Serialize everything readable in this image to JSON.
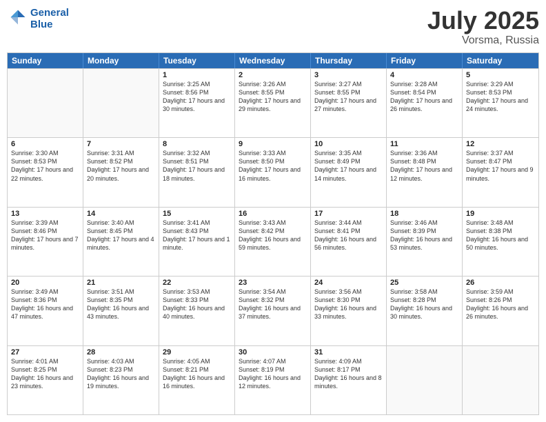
{
  "header": {
    "logo_line1": "General",
    "logo_line2": "Blue",
    "main_title": "July 2025",
    "subtitle": "Vorsma, Russia"
  },
  "calendar": {
    "days": [
      "Sunday",
      "Monday",
      "Tuesday",
      "Wednesday",
      "Thursday",
      "Friday",
      "Saturday"
    ],
    "rows": [
      [
        {
          "day": "",
          "info": ""
        },
        {
          "day": "",
          "info": ""
        },
        {
          "day": "1",
          "info": "Sunrise: 3:25 AM\nSunset: 8:56 PM\nDaylight: 17 hours and 30 minutes."
        },
        {
          "day": "2",
          "info": "Sunrise: 3:26 AM\nSunset: 8:55 PM\nDaylight: 17 hours and 29 minutes."
        },
        {
          "day": "3",
          "info": "Sunrise: 3:27 AM\nSunset: 8:55 PM\nDaylight: 17 hours and 27 minutes."
        },
        {
          "day": "4",
          "info": "Sunrise: 3:28 AM\nSunset: 8:54 PM\nDaylight: 17 hours and 26 minutes."
        },
        {
          "day": "5",
          "info": "Sunrise: 3:29 AM\nSunset: 8:53 PM\nDaylight: 17 hours and 24 minutes."
        }
      ],
      [
        {
          "day": "6",
          "info": "Sunrise: 3:30 AM\nSunset: 8:53 PM\nDaylight: 17 hours and 22 minutes."
        },
        {
          "day": "7",
          "info": "Sunrise: 3:31 AM\nSunset: 8:52 PM\nDaylight: 17 hours and 20 minutes."
        },
        {
          "day": "8",
          "info": "Sunrise: 3:32 AM\nSunset: 8:51 PM\nDaylight: 17 hours and 18 minutes."
        },
        {
          "day": "9",
          "info": "Sunrise: 3:33 AM\nSunset: 8:50 PM\nDaylight: 17 hours and 16 minutes."
        },
        {
          "day": "10",
          "info": "Sunrise: 3:35 AM\nSunset: 8:49 PM\nDaylight: 17 hours and 14 minutes."
        },
        {
          "day": "11",
          "info": "Sunrise: 3:36 AM\nSunset: 8:48 PM\nDaylight: 17 hours and 12 minutes."
        },
        {
          "day": "12",
          "info": "Sunrise: 3:37 AM\nSunset: 8:47 PM\nDaylight: 17 hours and 9 minutes."
        }
      ],
      [
        {
          "day": "13",
          "info": "Sunrise: 3:39 AM\nSunset: 8:46 PM\nDaylight: 17 hours and 7 minutes."
        },
        {
          "day": "14",
          "info": "Sunrise: 3:40 AM\nSunset: 8:45 PM\nDaylight: 17 hours and 4 minutes."
        },
        {
          "day": "15",
          "info": "Sunrise: 3:41 AM\nSunset: 8:43 PM\nDaylight: 17 hours and 1 minute."
        },
        {
          "day": "16",
          "info": "Sunrise: 3:43 AM\nSunset: 8:42 PM\nDaylight: 16 hours and 59 minutes."
        },
        {
          "day": "17",
          "info": "Sunrise: 3:44 AM\nSunset: 8:41 PM\nDaylight: 16 hours and 56 minutes."
        },
        {
          "day": "18",
          "info": "Sunrise: 3:46 AM\nSunset: 8:39 PM\nDaylight: 16 hours and 53 minutes."
        },
        {
          "day": "19",
          "info": "Sunrise: 3:48 AM\nSunset: 8:38 PM\nDaylight: 16 hours and 50 minutes."
        }
      ],
      [
        {
          "day": "20",
          "info": "Sunrise: 3:49 AM\nSunset: 8:36 PM\nDaylight: 16 hours and 47 minutes."
        },
        {
          "day": "21",
          "info": "Sunrise: 3:51 AM\nSunset: 8:35 PM\nDaylight: 16 hours and 43 minutes."
        },
        {
          "day": "22",
          "info": "Sunrise: 3:53 AM\nSunset: 8:33 PM\nDaylight: 16 hours and 40 minutes."
        },
        {
          "day": "23",
          "info": "Sunrise: 3:54 AM\nSunset: 8:32 PM\nDaylight: 16 hours and 37 minutes."
        },
        {
          "day": "24",
          "info": "Sunrise: 3:56 AM\nSunset: 8:30 PM\nDaylight: 16 hours and 33 minutes."
        },
        {
          "day": "25",
          "info": "Sunrise: 3:58 AM\nSunset: 8:28 PM\nDaylight: 16 hours and 30 minutes."
        },
        {
          "day": "26",
          "info": "Sunrise: 3:59 AM\nSunset: 8:26 PM\nDaylight: 16 hours and 26 minutes."
        }
      ],
      [
        {
          "day": "27",
          "info": "Sunrise: 4:01 AM\nSunset: 8:25 PM\nDaylight: 16 hours and 23 minutes."
        },
        {
          "day": "28",
          "info": "Sunrise: 4:03 AM\nSunset: 8:23 PM\nDaylight: 16 hours and 19 minutes."
        },
        {
          "day": "29",
          "info": "Sunrise: 4:05 AM\nSunset: 8:21 PM\nDaylight: 16 hours and 16 minutes."
        },
        {
          "day": "30",
          "info": "Sunrise: 4:07 AM\nSunset: 8:19 PM\nDaylight: 16 hours and 12 minutes."
        },
        {
          "day": "31",
          "info": "Sunrise: 4:09 AM\nSunset: 8:17 PM\nDaylight: 16 hours and 8 minutes."
        },
        {
          "day": "",
          "info": ""
        },
        {
          "day": "",
          "info": ""
        }
      ]
    ]
  }
}
